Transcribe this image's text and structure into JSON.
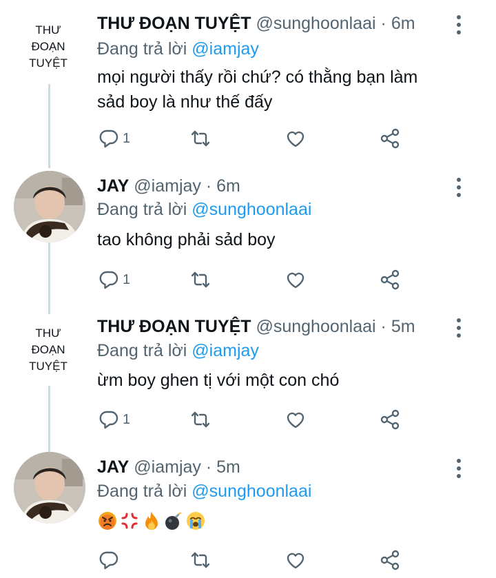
{
  "tweets": [
    {
      "avatar_text": [
        "THƯ",
        "ĐOẠN",
        "TUYỆT"
      ],
      "name": "THƯ ĐOẠN TUYỆT",
      "handle": "@sunghoonlaai",
      "dot": "·",
      "time": "6m",
      "reply_prefix": "Đang trả lời",
      "reply_mention": "@iamjay",
      "body_lines": [
        "mọi người thấy rồi chứ? có thằng bạn làm",
        "sảd boy là như thế đấy"
      ],
      "reply_count": "1"
    },
    {
      "name": "JAY",
      "handle": "@iamjay",
      "dot": "·",
      "time": "6m",
      "reply_prefix": "Đang trả lời",
      "reply_mention": "@sunghoonlaai",
      "body_lines": [
        "tao không phải sảd boy"
      ],
      "reply_count": "1"
    },
    {
      "avatar_text": [
        "THƯ",
        "ĐOẠN",
        "TUYỆT"
      ],
      "name": "THƯ ĐOẠN TUYỆT",
      "handle": "@sunghoonlaai",
      "dot": "·",
      "time": "5m",
      "reply_prefix": "Đang trả lời",
      "reply_mention": "@iamjay",
      "body_lines": [
        "ừm boy ghen tị với một con chó"
      ],
      "reply_count": "1"
    },
    {
      "name": "JAY",
      "handle": "@iamjay",
      "dot": "·",
      "time": "5m",
      "reply_prefix": "Đang trả lời",
      "reply_mention": "@sunghoonlaai",
      "emojis": [
        "angry-face",
        "anger-symbol",
        "fire",
        "bomb",
        "loudly-crying-face"
      ],
      "reply_count": ""
    }
  ],
  "icons": {
    "reply": "reply-icon",
    "retweet": "retweet-icon",
    "like": "heart-icon",
    "share": "share-icon",
    "more": "more-vertical-icon"
  },
  "colors": {
    "mention": "#1d9bf0",
    "muted": "#536471",
    "text": "#0f1419",
    "thread_line": "#cfd9de"
  }
}
